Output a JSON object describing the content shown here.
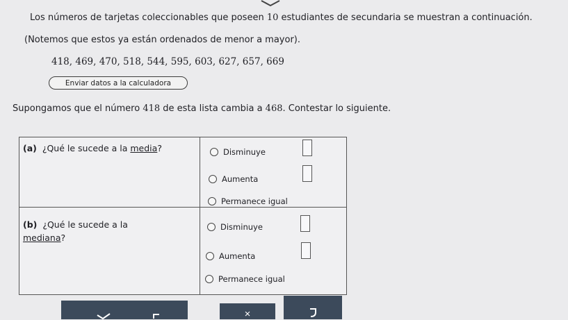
{
  "intro": {
    "line1": "Los números de tarjetas coleccionables que poseen ",
    "count": "10",
    "line1_end": " estudiantes de secundaria se muestran a continuación.",
    "line2": "(Notemos que estos ya están ordenados de menor a mayor)."
  },
  "data_values": "418, 469, 470, 518, 544, 595, 603, 627, 657, 669",
  "calc_button": "Enviar datos a la calculadora",
  "prompt": {
    "text_a": "Supongamos que el número ",
    "old": "418",
    "text_b": " de esta lista cambia a ",
    "new": "468",
    "text_c": ". Contestar lo siguiente."
  },
  "questions": [
    {
      "label": "(a)",
      "text": "¿Qué le sucede a la ",
      "term": "media",
      "end": "?"
    },
    {
      "label": "(b)",
      "text": "¿Qué le sucede a la ",
      "term": "mediana",
      "end": "?"
    }
  ],
  "options": [
    "Disminuye",
    "Aumenta",
    "Permanece igual"
  ],
  "toolbar": {
    "check_icon": "check-icon",
    "undo_icon": "undo-icon",
    "clear_icon": "x-icon",
    "redo_icon": "redo-icon",
    "clear_symbol": "×"
  }
}
